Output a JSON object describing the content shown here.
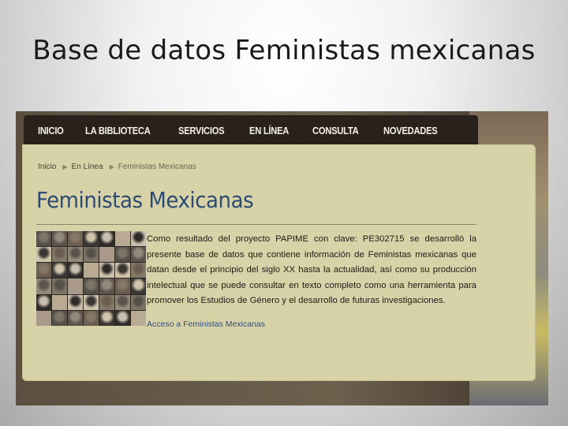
{
  "slide": {
    "title": "Base de datos Feministas mexicanas"
  },
  "site": {
    "nav": [
      "INICIO",
      "LA BIBLIOTECA",
      "SERVICIOS",
      "EN LÍNEA",
      "CONSULTA",
      "NOVEDADES"
    ],
    "breadcrumb": {
      "home": "Inicio",
      "section": "En Línea",
      "current": "Feministas Mexicanas"
    },
    "heading": "Feministas Mexicanas",
    "description": "Como resultado del proyecto PAPIME con clave: PE302715 se desarrolló la presente base de datos que contiene información de Feministas mexicanas que datan desde el principio del siglo XX hasta la actualidad, así como su producción intelectual que se puede consultar en texto completo como una herramienta para promover los Estudios de Género y el desarrollo de futuras investigaciones.",
    "access_link": "Acceso a Feministas Mexicanas"
  },
  "colors": {
    "nav_bg": "#2a211c",
    "panel_bg": "#d8d2a8",
    "heading": "#2c4b73",
    "link": "#2e4e7d"
  },
  "icons": {
    "breadcrumb_separator": "triangle-right-icon"
  }
}
